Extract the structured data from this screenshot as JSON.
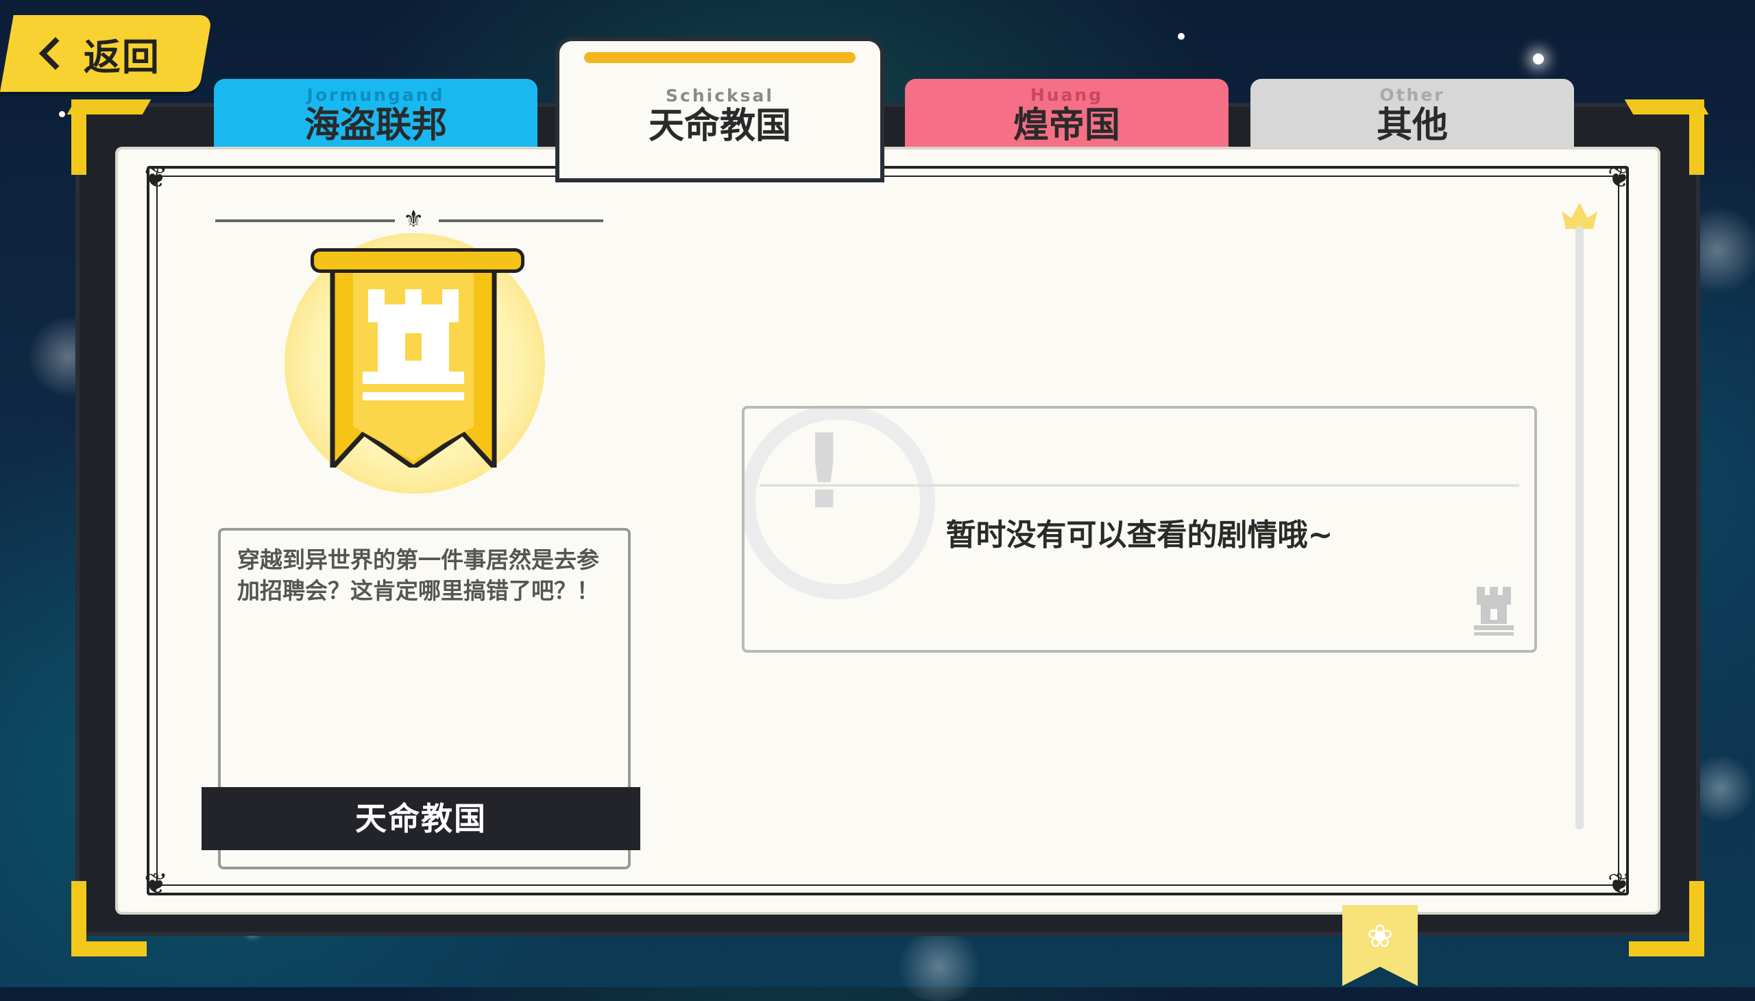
{
  "back_button": {
    "label": "返回"
  },
  "tabs": [
    {
      "sub": "Jormungand",
      "name": "海盗联邦",
      "color": "#1ab8f0"
    },
    {
      "sub": "Schicksal",
      "name": "天命教国",
      "color": "#fbfaf5",
      "active": true
    },
    {
      "sub": "Huang",
      "name": "煌帝国",
      "color": "#f56f86"
    },
    {
      "sub": "Other",
      "name": "其他",
      "color": "#d7d7d7"
    }
  ],
  "faction": {
    "description": "穿越到异世界的第一件事居然是去参加招聘会？这肯定哪里搞错了吧？！",
    "name": "天命教国"
  },
  "notice": {
    "text": "暂时没有可以查看的剧情哦~"
  },
  "icons": {
    "back": "chevron-left-icon",
    "banner": "castle-tower-banner-icon",
    "notice_mark": "exclamation-icon",
    "crown": "crown-icon",
    "bookmark": "lotus-icon"
  },
  "colors": {
    "accent": "#f2c81c",
    "active_bar": "#f4b61d",
    "frame": "#1f2228",
    "panel": "#fbfaf5"
  }
}
